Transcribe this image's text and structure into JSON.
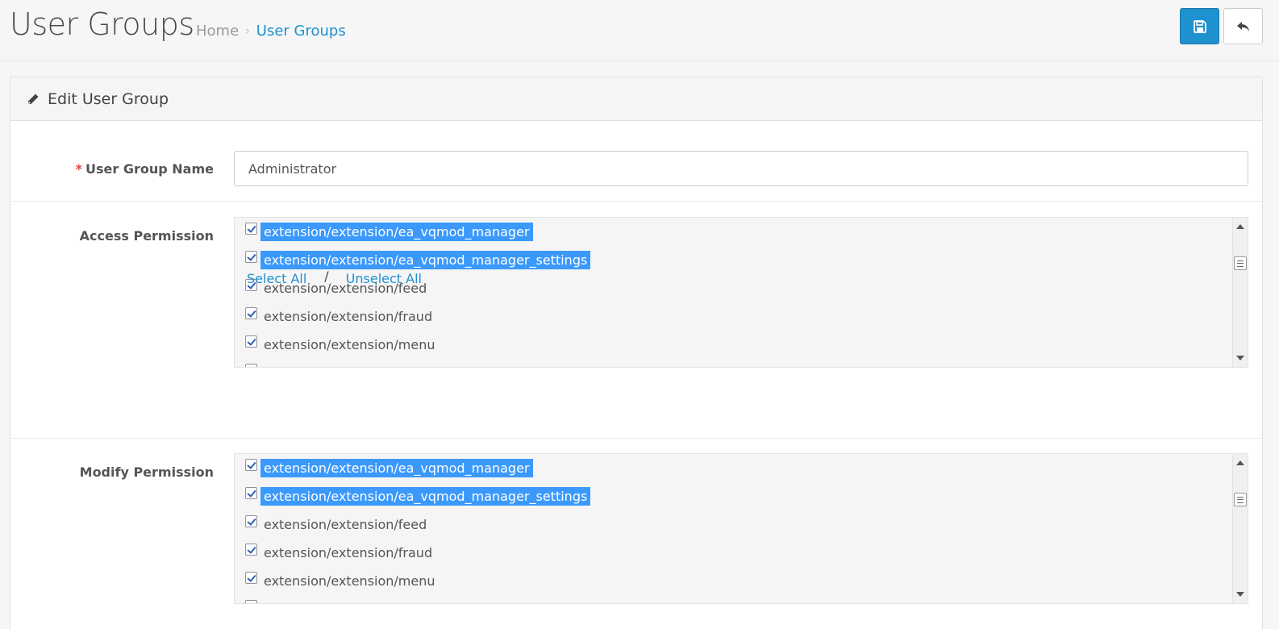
{
  "header": {
    "title": "User Groups",
    "breadcrumb": {
      "home": "Home",
      "separator": "›",
      "current": "User Groups"
    }
  },
  "buttons": {
    "save_icon": "floppy-disk-icon",
    "back_icon": "reply-arrow-icon"
  },
  "panel": {
    "title": "Edit User Group",
    "title_icon": "pencil-icon"
  },
  "form": {
    "group_name": {
      "required_mark": "*",
      "label": "User Group Name",
      "value": "Administrator"
    },
    "access": {
      "label": "Access Permission",
      "items": [
        {
          "text": "extension/extension/ea_vqmod_manager"
        },
        {
          "text": "extension/extension/ea_vqmod_manager_settings"
        },
        {
          "text": "extension/extension/feed"
        },
        {
          "text": "extension/extension/fraud"
        },
        {
          "text": "extension/extension/menu"
        }
      ],
      "select_all": "Select All",
      "separator": "/",
      "unselect_all": "Unselect All"
    },
    "modify": {
      "label": "Modify Permission",
      "items": [
        {
          "text": "extension/extension/ea_vqmod_manager"
        },
        {
          "text": "extension/extension/ea_vqmod_manager_settings"
        },
        {
          "text": "extension/extension/feed"
        },
        {
          "text": "extension/extension/fraud"
        },
        {
          "text": "extension/extension/menu"
        }
      ]
    }
  },
  "colors": {
    "accent": "#1e91cf",
    "selection": "#3b99fc",
    "required": "#e3403c"
  }
}
